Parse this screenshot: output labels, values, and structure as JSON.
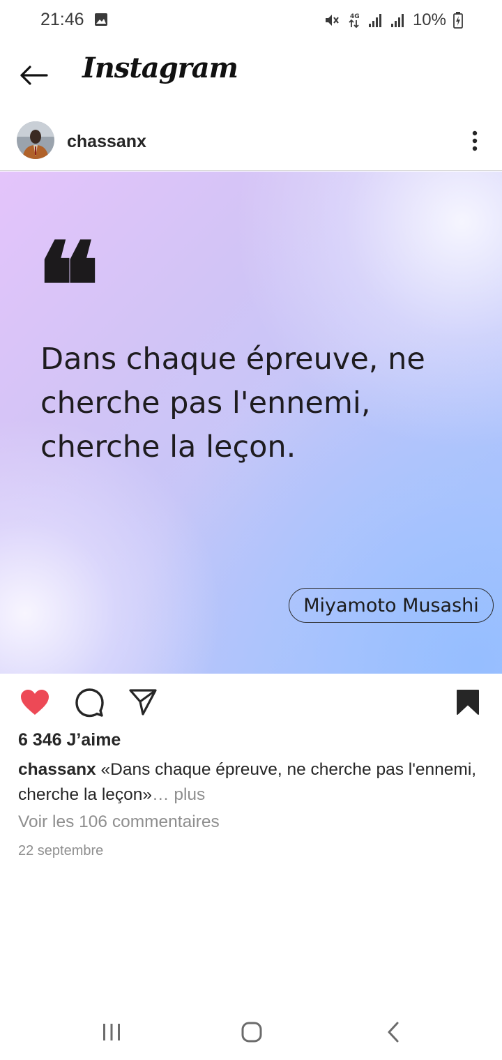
{
  "status_bar": {
    "time": "21:46",
    "battery": "10%",
    "network": "4G",
    "icons": [
      "image-icon",
      "mute-icon",
      "data-arrows-icon",
      "signal-icon",
      "signal-icon",
      "battery-charging-icon"
    ]
  },
  "header": {
    "app_title": "Instagram",
    "back_icon": "arrow-left-icon"
  },
  "post": {
    "username": "chassanx",
    "more_icon": "vertical-dots-icon",
    "image": {
      "quote_mark": "❝",
      "quote_text": "Dans chaque épreuve, ne cherche pas l'ennemi, cherche la leçon.",
      "author": "Miyamoto Musashi"
    },
    "actions": {
      "like_icon": "heart-filled-icon",
      "comment_icon": "comment-icon",
      "share_icon": "send-icon",
      "save_icon": "bookmark-filled-icon"
    },
    "likes": "6 346 J’aime",
    "caption_user": "chassanx",
    "caption_text": " «Dans chaque épreuve, ne cherche pas l'ennemi, cherche la leçon»",
    "caption_more": "… plus",
    "comments_link": "Voir les 106 commentaires",
    "date": "22 septembre"
  },
  "colors": {
    "like_red": "#ed4956",
    "text_primary": "#262626",
    "text_secondary": "#8e8e8e"
  },
  "nav_bar": {
    "icons": [
      "recent-apps-icon",
      "home-icon",
      "back-chevron-icon"
    ]
  }
}
